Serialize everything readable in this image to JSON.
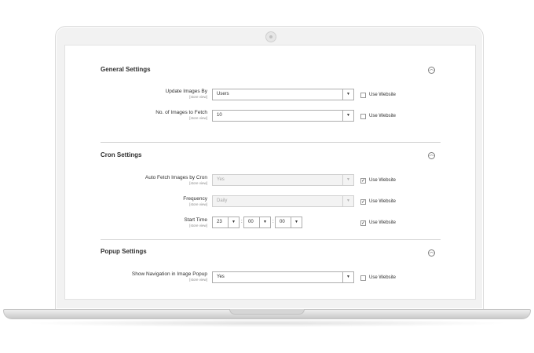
{
  "sections": {
    "general": {
      "title": "General Settings",
      "fields": {
        "update_images_by": {
          "label": "Update Images By",
          "scope": "[store view]",
          "value": "Users",
          "use_website": "Use Website",
          "use_website_checked": false
        },
        "num_images": {
          "label": "No. of Images to Fetch",
          "scope": "[store view]",
          "value": "10",
          "use_website": "Use Website",
          "use_website_checked": false
        }
      }
    },
    "cron": {
      "title": "Cron Settings",
      "fields": {
        "auto_fetch": {
          "label": "Auto Fetch Images by Cron",
          "scope": "[store view]",
          "value": "Yes",
          "use_website": "Use Website",
          "use_website_checked": true
        },
        "frequency": {
          "label": "Frequency",
          "scope": "[store view]",
          "value": "Daily",
          "use_website": "Use Website",
          "use_website_checked": true
        },
        "start_time": {
          "label": "Start Time",
          "scope": "[store view]",
          "hour": "23",
          "minute": "00",
          "second": "00",
          "separator": ":",
          "use_website": "Use Website",
          "use_website_checked": true
        }
      }
    },
    "popup": {
      "title": "Popup Settings",
      "fields": {
        "show_navigation": {
          "label": "Show Navigation in Image Popup",
          "scope": "[store view]",
          "value": "Yes",
          "use_website": "Use Website",
          "use_website_checked": false
        }
      }
    }
  },
  "icons": {
    "collapse": "chevron-up-circle-icon",
    "dropdown": "caret-down-icon",
    "check": "checkmark-icon"
  },
  "glyphs": {
    "collapse": "︿",
    "dropdown": "▼",
    "check": "✓"
  },
  "colors": {
    "frame": "#f2f2f2",
    "border": "#adadad",
    "text": "#303030",
    "scope_text": "#8a8a8a"
  }
}
